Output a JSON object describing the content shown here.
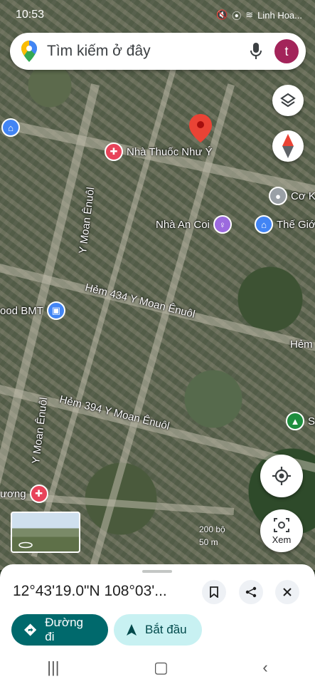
{
  "status_bar": {
    "time": "10:53",
    "right_text": "Linh Hoa...",
    "battery": ""
  },
  "search": {
    "placeholder": "Tìm kiếm ở đây",
    "avatar_letter": "t"
  },
  "map": {
    "streets": [
      "Y Moan Ênuôl",
      "Hẻm 434 Y Moan Ênuôl",
      "Hẻm 394 Y Moan Ênuôl",
      "Y Moan Ênuôl"
    ],
    "pois": [
      {
        "label": "Nhà Thuốc Như Ý",
        "color": "#e8435a"
      },
      {
        "label": "Nhà An Coi",
        "color": "#9c6ade"
      },
      {
        "label": "Thế Giớ",
        "color": "#4285f4"
      },
      {
        "label": "Cơ K",
        "color": "#9aa0a6"
      },
      {
        "label": "ood BMT",
        "color": "#4285f4"
      },
      {
        "label": "Hẻm",
        "color": ""
      },
      {
        "label": "S",
        "color": "#1e8e3e"
      },
      {
        "label": "ương",
        "color": "#e8435a"
      }
    ],
    "scale": {
      "upper": "200 bộ",
      "lower": "50 m"
    }
  },
  "controls": {
    "street_view_label": "Xem"
  },
  "sheet": {
    "coordinates": "12°43'19.0\"N 108°03'...",
    "directions_label": "Đường đi",
    "start_label": "Bắt đầu"
  }
}
